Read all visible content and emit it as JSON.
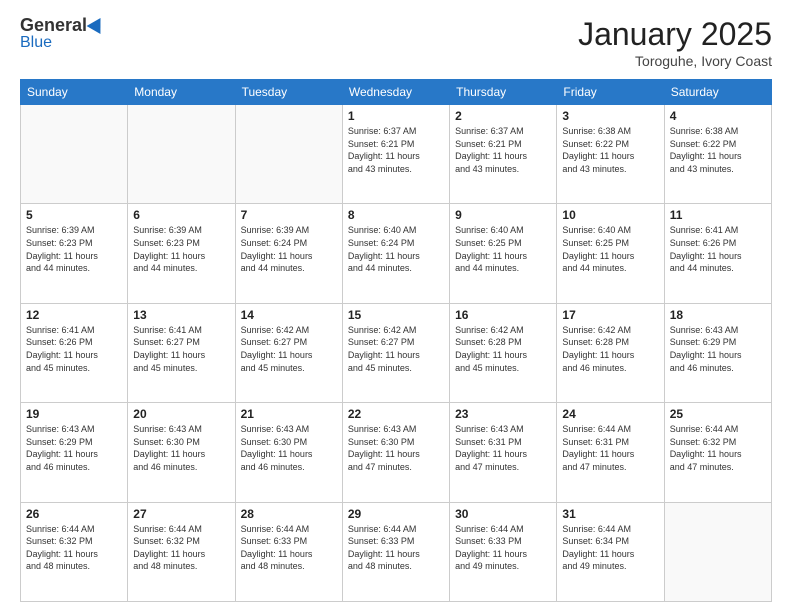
{
  "header": {
    "logo_general": "General",
    "logo_blue": "Blue",
    "title": "January 2025",
    "location": "Toroguhe, Ivory Coast"
  },
  "days_of_week": [
    "Sunday",
    "Monday",
    "Tuesday",
    "Wednesday",
    "Thursday",
    "Friday",
    "Saturday"
  ],
  "weeks": [
    [
      {
        "day": "",
        "info": ""
      },
      {
        "day": "",
        "info": ""
      },
      {
        "day": "",
        "info": ""
      },
      {
        "day": "1",
        "info": "Sunrise: 6:37 AM\nSunset: 6:21 PM\nDaylight: 11 hours\nand 43 minutes."
      },
      {
        "day": "2",
        "info": "Sunrise: 6:37 AM\nSunset: 6:21 PM\nDaylight: 11 hours\nand 43 minutes."
      },
      {
        "day": "3",
        "info": "Sunrise: 6:38 AM\nSunset: 6:22 PM\nDaylight: 11 hours\nand 43 minutes."
      },
      {
        "day": "4",
        "info": "Sunrise: 6:38 AM\nSunset: 6:22 PM\nDaylight: 11 hours\nand 43 minutes."
      }
    ],
    [
      {
        "day": "5",
        "info": "Sunrise: 6:39 AM\nSunset: 6:23 PM\nDaylight: 11 hours\nand 44 minutes."
      },
      {
        "day": "6",
        "info": "Sunrise: 6:39 AM\nSunset: 6:23 PM\nDaylight: 11 hours\nand 44 minutes."
      },
      {
        "day": "7",
        "info": "Sunrise: 6:39 AM\nSunset: 6:24 PM\nDaylight: 11 hours\nand 44 minutes."
      },
      {
        "day": "8",
        "info": "Sunrise: 6:40 AM\nSunset: 6:24 PM\nDaylight: 11 hours\nand 44 minutes."
      },
      {
        "day": "9",
        "info": "Sunrise: 6:40 AM\nSunset: 6:25 PM\nDaylight: 11 hours\nand 44 minutes."
      },
      {
        "day": "10",
        "info": "Sunrise: 6:40 AM\nSunset: 6:25 PM\nDaylight: 11 hours\nand 44 minutes."
      },
      {
        "day": "11",
        "info": "Sunrise: 6:41 AM\nSunset: 6:26 PM\nDaylight: 11 hours\nand 44 minutes."
      }
    ],
    [
      {
        "day": "12",
        "info": "Sunrise: 6:41 AM\nSunset: 6:26 PM\nDaylight: 11 hours\nand 45 minutes."
      },
      {
        "day": "13",
        "info": "Sunrise: 6:41 AM\nSunset: 6:27 PM\nDaylight: 11 hours\nand 45 minutes."
      },
      {
        "day": "14",
        "info": "Sunrise: 6:42 AM\nSunset: 6:27 PM\nDaylight: 11 hours\nand 45 minutes."
      },
      {
        "day": "15",
        "info": "Sunrise: 6:42 AM\nSunset: 6:27 PM\nDaylight: 11 hours\nand 45 minutes."
      },
      {
        "day": "16",
        "info": "Sunrise: 6:42 AM\nSunset: 6:28 PM\nDaylight: 11 hours\nand 45 minutes."
      },
      {
        "day": "17",
        "info": "Sunrise: 6:42 AM\nSunset: 6:28 PM\nDaylight: 11 hours\nand 46 minutes."
      },
      {
        "day": "18",
        "info": "Sunrise: 6:43 AM\nSunset: 6:29 PM\nDaylight: 11 hours\nand 46 minutes."
      }
    ],
    [
      {
        "day": "19",
        "info": "Sunrise: 6:43 AM\nSunset: 6:29 PM\nDaylight: 11 hours\nand 46 minutes."
      },
      {
        "day": "20",
        "info": "Sunrise: 6:43 AM\nSunset: 6:30 PM\nDaylight: 11 hours\nand 46 minutes."
      },
      {
        "day": "21",
        "info": "Sunrise: 6:43 AM\nSunset: 6:30 PM\nDaylight: 11 hours\nand 46 minutes."
      },
      {
        "day": "22",
        "info": "Sunrise: 6:43 AM\nSunset: 6:30 PM\nDaylight: 11 hours\nand 47 minutes."
      },
      {
        "day": "23",
        "info": "Sunrise: 6:43 AM\nSunset: 6:31 PM\nDaylight: 11 hours\nand 47 minutes."
      },
      {
        "day": "24",
        "info": "Sunrise: 6:44 AM\nSunset: 6:31 PM\nDaylight: 11 hours\nand 47 minutes."
      },
      {
        "day": "25",
        "info": "Sunrise: 6:44 AM\nSunset: 6:32 PM\nDaylight: 11 hours\nand 47 minutes."
      }
    ],
    [
      {
        "day": "26",
        "info": "Sunrise: 6:44 AM\nSunset: 6:32 PM\nDaylight: 11 hours\nand 48 minutes."
      },
      {
        "day": "27",
        "info": "Sunrise: 6:44 AM\nSunset: 6:32 PM\nDaylight: 11 hours\nand 48 minutes."
      },
      {
        "day": "28",
        "info": "Sunrise: 6:44 AM\nSunset: 6:33 PM\nDaylight: 11 hours\nand 48 minutes."
      },
      {
        "day": "29",
        "info": "Sunrise: 6:44 AM\nSunset: 6:33 PM\nDaylight: 11 hours\nand 48 minutes."
      },
      {
        "day": "30",
        "info": "Sunrise: 6:44 AM\nSunset: 6:33 PM\nDaylight: 11 hours\nand 49 minutes."
      },
      {
        "day": "31",
        "info": "Sunrise: 6:44 AM\nSunset: 6:34 PM\nDaylight: 11 hours\nand 49 minutes."
      },
      {
        "day": "",
        "info": ""
      }
    ]
  ]
}
